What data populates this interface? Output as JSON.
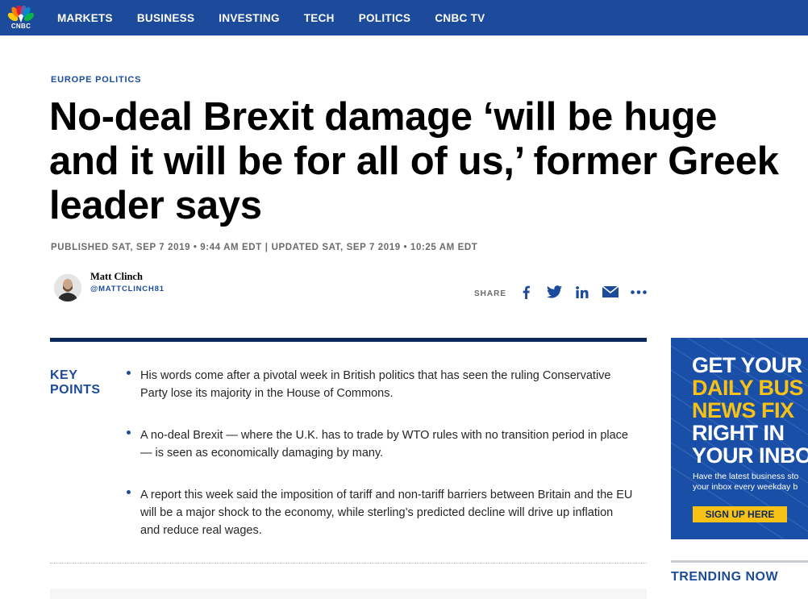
{
  "nav": {
    "logo_text": "CNBC",
    "items": [
      "MARKETS",
      "BUSINESS",
      "INVESTING",
      "TECH",
      "POLITICS",
      "CNBC TV"
    ]
  },
  "article": {
    "section": "EUROPE POLITICS",
    "headline": "No-deal Brexit damage ‘will be huge and it will be for all of us,’ former Greek leader says",
    "published": "PUBLISHED SAT, SEP 7 2019 • 9:44 AM EDT",
    "updated": "UPDATED SAT, SEP 7 2019 • 10:25 AM EDT",
    "separator": "|"
  },
  "author": {
    "name": "Matt Clinch",
    "handle": "@MATTCLINCH81"
  },
  "share": {
    "label": "SHARE",
    "icons": [
      "facebook-icon",
      "twitter-icon",
      "linkedin-icon",
      "email-icon",
      "more-icon"
    ]
  },
  "key_points": {
    "title_line1": "KEY",
    "title_line2": "POINTS",
    "items": [
      "His words come after a pivotal week in British politics that has seen the ruling Conservative Party lose its majority in the House of Commons.",
      "A no-deal Brexit — where the U.K. has to trade by WTO rules with no transition period in place — is seen as economically damaging by many.",
      "A report this week said the imposition of tariff and non-tariff barriers between Britain and the EU will be a major shock to the economy, while sterling’s predicted decline will drive up inflation and reduce real wages."
    ]
  },
  "ad": {
    "line1": "GET YOUR",
    "line2": "DAILY BUS",
    "line3": "NEWS FIX",
    "line4": "RIGHT IN",
    "line5": "YOUR INBO",
    "sub1": "Have the latest business sto",
    "sub2": "your inbox every weekday b",
    "button": "SIGN UP HERE"
  },
  "sidebar": {
    "trending": "TRENDING NOW"
  },
  "colors": {
    "nav_bg": "#1c4b9b",
    "accent_blue": "#1c4b9b",
    "dark_rule": "#0b2a5b",
    "ad_yellow": "#f7c116"
  }
}
